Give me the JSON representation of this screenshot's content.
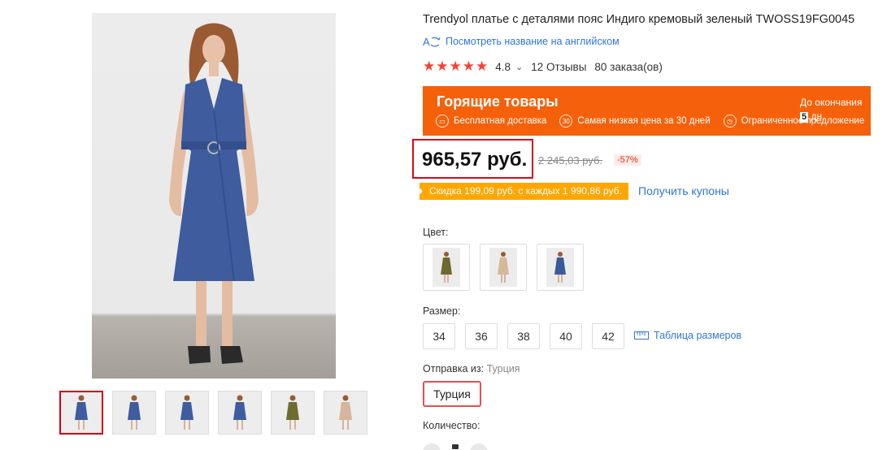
{
  "product": {
    "title": "Trendyol платье с деталями пояс Индиго кремовый зеленый TWOSS19FG0045",
    "translate_link": "Посмотреть название на английском",
    "rating": "4.8",
    "reviews": "12 Отзывы",
    "orders": "80 заказа(ов)",
    "stars": "★★★★★"
  },
  "promo": {
    "title": "Горящие товары",
    "features": [
      "Бесплатная доставка",
      "Самая низкая цена за 30 дней",
      "Ограниченное предложение"
    ],
    "countdown_label": "До окончания",
    "countdown_days": "5",
    "countdown_unit": "дн"
  },
  "price": {
    "current": "965,57 руб.",
    "old": "2 245,03 руб.",
    "discount": "-57%"
  },
  "coupon": {
    "text": "Скидка 199,09 руб. с каждых 1 990,86 руб.",
    "link": "Получить купоны"
  },
  "options": {
    "color_label": "Цвет:",
    "colors": [
      {
        "name": "olive-green",
        "color": "#6b6a2e"
      },
      {
        "name": "cream",
        "color": "#d6b89a"
      },
      {
        "name": "indigo",
        "color": "#3b5998"
      }
    ],
    "size_label": "Размер:",
    "sizes": [
      "34",
      "36",
      "38",
      "40",
      "42"
    ],
    "size_chart": "Таблица размеров",
    "ship_label": "Отправка из:",
    "ship_value": "Турция",
    "ship_button": "Турция",
    "quantity_label": "Количество:"
  },
  "colors": {
    "accent_red": "#d50a1c",
    "promo_orange": "#f5610a",
    "coupon_orange": "#ffa600",
    "link_blue": "#2f76d3",
    "dress_indigo": "#3e5c9e"
  },
  "thumbnails": [
    {
      "name": "indigo",
      "color": "#3e5c9e"
    },
    {
      "name": "indigo",
      "color": "#3e5c9e"
    },
    {
      "name": "indigo",
      "color": "#3e5c9e"
    },
    {
      "name": "indigo",
      "color": "#3e5c9e"
    },
    {
      "name": "olive-green",
      "color": "#6e6c2f"
    },
    {
      "name": "cream",
      "color": "#d6b59a"
    }
  ]
}
